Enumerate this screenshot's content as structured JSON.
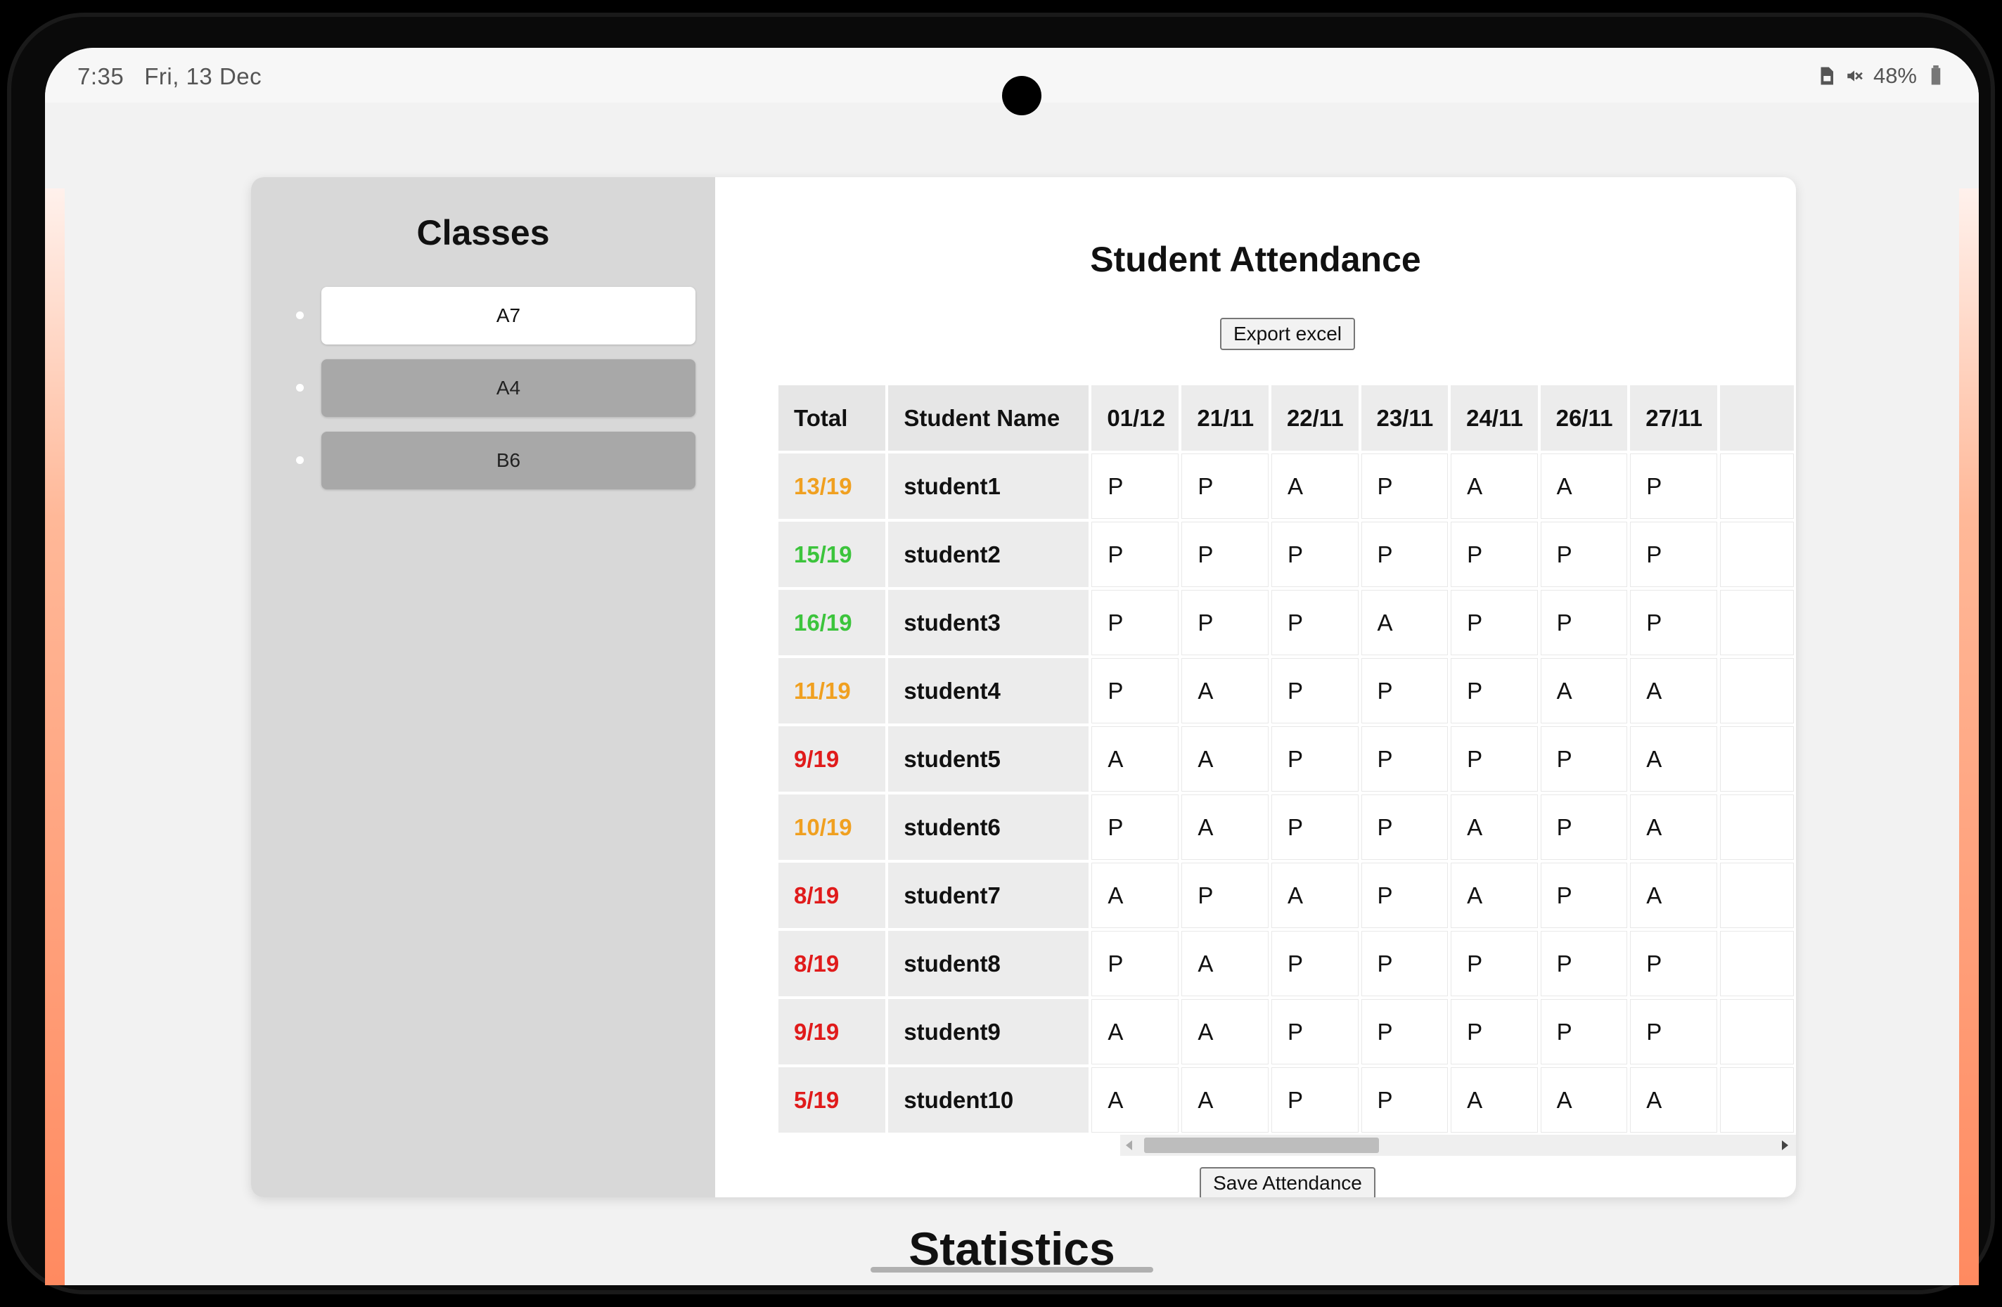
{
  "status_bar": {
    "time": "7:35",
    "date": "Fri, 13 Dec",
    "battery": "48%"
  },
  "sidebar": {
    "title": "Classes",
    "classes": [
      {
        "label": "A7",
        "active": true
      },
      {
        "label": "A4",
        "active": false
      },
      {
        "label": "B6",
        "active": false
      }
    ]
  },
  "main": {
    "title": "Student Attendance",
    "export_label": "Export excel",
    "save_label": "Save Attendance",
    "columns": {
      "total": "Total",
      "name": "Student Name",
      "dates": [
        "01/12",
        "21/11",
        "22/11",
        "23/11",
        "24/11",
        "26/11",
        "27/11"
      ]
    },
    "rows": [
      {
        "total": "13/19",
        "total_color": "#f0a020",
        "name": "student1",
        "marks": [
          "P",
          "P",
          "A",
          "P",
          "A",
          "A",
          "P"
        ]
      },
      {
        "total": "15/19",
        "total_color": "#3cc43c",
        "name": "student2",
        "marks": [
          "P",
          "P",
          "P",
          "P",
          "P",
          "P",
          "P"
        ]
      },
      {
        "total": "16/19",
        "total_color": "#3cc43c",
        "name": "student3",
        "marks": [
          "P",
          "P",
          "P",
          "A",
          "P",
          "P",
          "P"
        ]
      },
      {
        "total": "11/19",
        "total_color": "#f0a020",
        "name": "student4",
        "marks": [
          "P",
          "A",
          "P",
          "P",
          "P",
          "A",
          "A"
        ]
      },
      {
        "total": "9/19",
        "total_color": "#e01b1b",
        "name": "student5",
        "marks": [
          "A",
          "A",
          "P",
          "P",
          "P",
          "P",
          "A"
        ]
      },
      {
        "total": "10/19",
        "total_color": "#f0a020",
        "name": "student6",
        "marks": [
          "P",
          "A",
          "P",
          "P",
          "A",
          "P",
          "A"
        ]
      },
      {
        "total": "8/19",
        "total_color": "#e01b1b",
        "name": "student7",
        "marks": [
          "A",
          "P",
          "A",
          "P",
          "A",
          "P",
          "A"
        ]
      },
      {
        "total": "8/19",
        "total_color": "#e01b1b",
        "name": "student8",
        "marks": [
          "P",
          "A",
          "P",
          "P",
          "P",
          "P",
          "P"
        ]
      },
      {
        "total": "9/19",
        "total_color": "#e01b1b",
        "name": "student9",
        "marks": [
          "A",
          "A",
          "P",
          "P",
          "P",
          "P",
          "P"
        ]
      },
      {
        "total": "5/19",
        "total_color": "#e01b1b",
        "name": "student10",
        "marks": [
          "A",
          "A",
          "P",
          "P",
          "A",
          "A",
          "A"
        ]
      }
    ]
  },
  "statistics": {
    "title": "Statistics"
  }
}
